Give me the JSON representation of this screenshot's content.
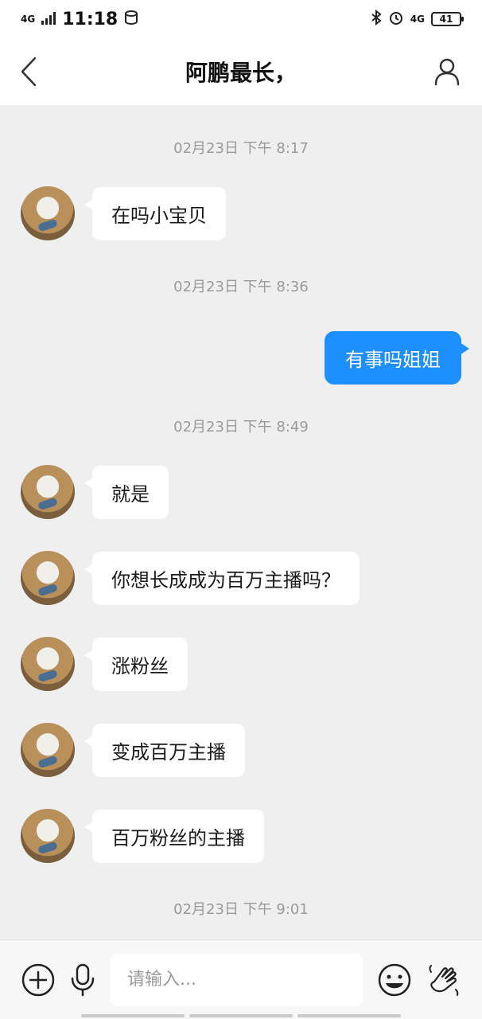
{
  "status_bar": {
    "time": "11:18",
    "network": "4G",
    "network_right": "4G",
    "battery": "41"
  },
  "header": {
    "title": "阿鹏最长，"
  },
  "messages": [
    {
      "type": "time",
      "text": "02月23日 下午 8:17"
    },
    {
      "type": "in",
      "text": "在吗小宝贝"
    },
    {
      "type": "time",
      "text": "02月23日 下午 8:36"
    },
    {
      "type": "out",
      "text": "有事吗姐姐"
    },
    {
      "type": "time",
      "text": "02月23日 下午 8:49"
    },
    {
      "type": "in",
      "text": "就是"
    },
    {
      "type": "in",
      "text": "你想长成成为百万主播吗？"
    },
    {
      "type": "in",
      "text": "涨粉丝"
    },
    {
      "type": "in",
      "text": "变成百万主播"
    },
    {
      "type": "in",
      "text": "百万粉丝的主播"
    },
    {
      "type": "time",
      "text": "02月23日 下午 9:01"
    }
  ],
  "input": {
    "placeholder": "请输入..."
  },
  "icons": {
    "back": "chevron-left-icon",
    "profile": "user-icon",
    "add": "plus-circle-icon",
    "mic": "microphone-icon",
    "emoji": "emoji-icon",
    "gesture": "hand-wave-icon"
  }
}
